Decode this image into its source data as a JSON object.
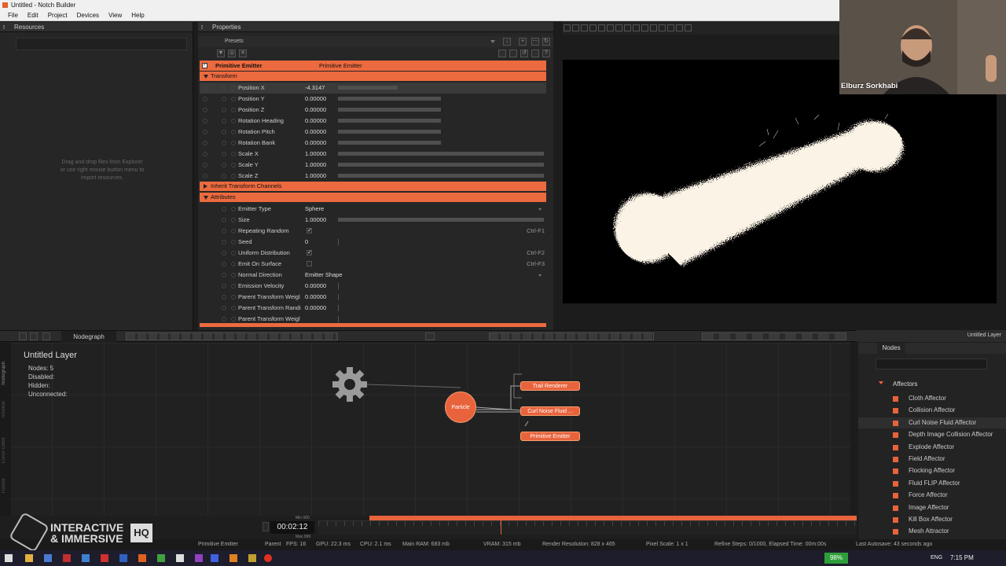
{
  "window": {
    "title": "Untitled - Notch Builder"
  },
  "menu": [
    "File",
    "Edit",
    "Project",
    "Devices",
    "View",
    "Help"
  ],
  "resources": {
    "header": "Resources",
    "hint": "Drag and drop files from Explorer\nor use right mouse button menu to\nimport resources."
  },
  "properties": {
    "header": "Properties",
    "presets_label": "Presets",
    "node_name": "Primitive Emitter",
    "node_type": "Primitive Emitter",
    "sections": {
      "transform": "Transform",
      "inherit": "Inherit Transform Channels",
      "attributes": "Attributes"
    },
    "transform": [
      {
        "label": "Position X",
        "value": "-4.3147",
        "fill": 0.29
      },
      {
        "label": "Position Y",
        "value": "0.00000",
        "fill": 0.5
      },
      {
        "label": "Position Z",
        "value": "0.00000",
        "fill": 0.5
      },
      {
        "label": "Rotation Heading",
        "value": "0.00000",
        "fill": 0.5
      },
      {
        "label": "Rotation Pitch",
        "value": "0.00000",
        "fill": 0.5
      },
      {
        "label": "Rotation Bank",
        "value": "0.00000",
        "fill": 0.5
      },
      {
        "label": "Scale X",
        "value": "1.00000",
        "fill": 1.0
      },
      {
        "label": "Scale Y",
        "value": "1.00000",
        "fill": 1.0
      },
      {
        "label": "Scale Z",
        "value": "1.00000",
        "fill": 1.0
      }
    ],
    "attributes": [
      {
        "label": "Emitter Type",
        "value": "Sphere",
        "kind": "select"
      },
      {
        "label": "Size",
        "value": "1.00000",
        "kind": "slider",
        "fill": 1.0
      },
      {
        "label": "Repeating Random",
        "value": "✓",
        "kind": "check",
        "shortcut": "Ctrl-F1"
      },
      {
        "label": "Seed",
        "value": "0",
        "kind": "text"
      },
      {
        "label": "Uniform Distribution",
        "value": "✓",
        "kind": "check",
        "shortcut": "Ctrl-F2"
      },
      {
        "label": "Emit On Surface",
        "value": "",
        "kind": "check",
        "shortcut": "Ctrl-F3"
      },
      {
        "label": "Normal Direction",
        "value": "Emitter Shape",
        "kind": "select"
      },
      {
        "label": "Emission Velocity",
        "value": "0.00000",
        "kind": "text"
      },
      {
        "label": "Parent Transform Weigl",
        "value": "0.00000",
        "kind": "text"
      },
      {
        "label": "Parent Transform Randi",
        "value": "0.00000",
        "kind": "text"
      },
      {
        "label": "Parent Transform Weigl",
        "value": "",
        "kind": "text"
      }
    ]
  },
  "webcam": {
    "name": "Elburz Sorkhabi"
  },
  "nodegraph": {
    "tab": "Nodegraph",
    "title": "Untitled  Layer",
    "stats": [
      "Nodes:  5",
      "Disabled:",
      "Hidden:",
      "Unconnected:"
    ],
    "nodes": {
      "particle": "Particle",
      "trail": "Trail Renderer",
      "curl": "Curl Noise Fluid ...",
      "emitter": "Primitive Emitter"
    },
    "side_tabs": [
      "Nodegraph",
      "Timeline",
      "Curve Editor",
      "Tracker"
    ]
  },
  "transport": {
    "layer": "Untitled Layer"
  },
  "nodes_panel": {
    "tab": "Nodes",
    "category": "Affectors",
    "items": [
      "Cloth Affector",
      "Collision Affector",
      "Curl Noise Fluid Affector",
      "Depth Image Collision Affector",
      "Explode Affector",
      "Field Affector",
      "Flocking Affector",
      "Fluid FLIP Affector",
      "Force Affector",
      "Image Affector",
      "Kill Box Affector",
      "Mesh Attractor"
    ]
  },
  "timeline": {
    "time": "00:02:12",
    "min": "Min 000",
    "max": "Max 999"
  },
  "status": {
    "selected": "Primitive Emitter",
    "parent": "Parent",
    "fps": "FPS: 16",
    "gpu": "GPU: 22.3 ms",
    "cpu": "CPU: 2.1 ms",
    "ram": "Main RAM: 683 mb",
    "vram": "VRAM: 315 mb",
    "res": "Render Resolution: 828 x 465",
    "pixel": "Pixel Scale: 1 x 1",
    "refine": "Refine Steps: 0/1000, Elapsed Time: 00m:00s",
    "autosave": "Last Autosave: 43 seconds ago"
  },
  "logo": {
    "line1": "INTERACTIVE",
    "line2": "& IMMERSIVE",
    "hq": "HQ"
  },
  "taskbar": {
    "battery": "98%",
    "lang": "ENG",
    "time": "7:15 PM"
  },
  "colors": {
    "accent": "#e8633c"
  }
}
